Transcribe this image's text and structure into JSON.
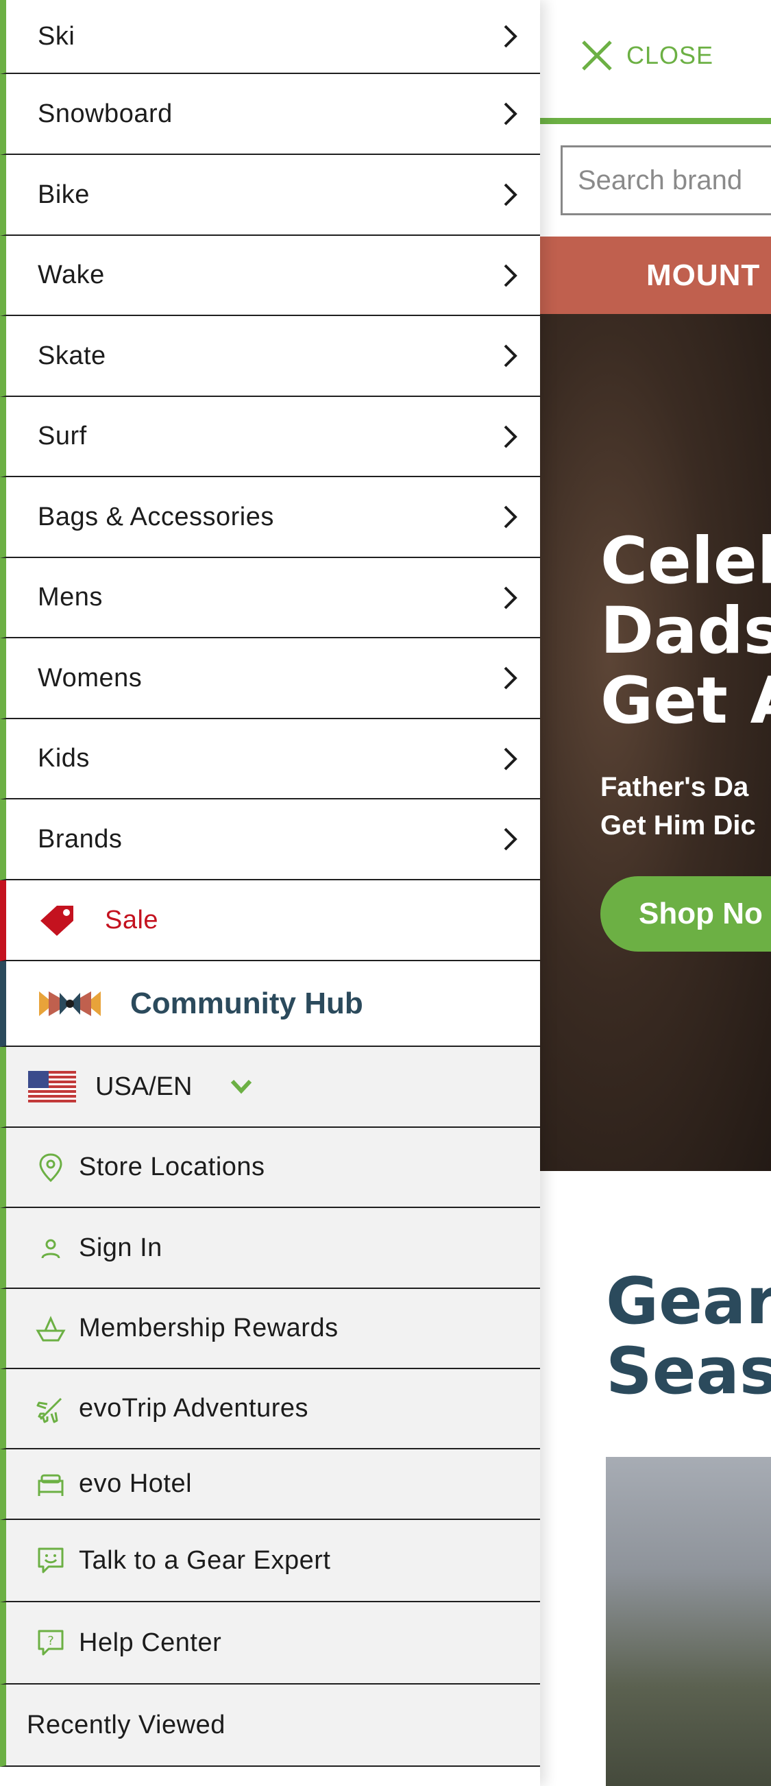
{
  "colors": {
    "accent_green": "#6cb044",
    "sale_red": "#c4121f",
    "community_navy": "#2b4a5c",
    "promo_bar": "#c0604e"
  },
  "drawer": {
    "categories": [
      {
        "label": "Ski"
      },
      {
        "label": "Snowboard"
      },
      {
        "label": "Bike"
      },
      {
        "label": "Wake"
      },
      {
        "label": "Skate"
      },
      {
        "label": "Surf"
      },
      {
        "label": "Bags & Accessories"
      },
      {
        "label": "Mens"
      },
      {
        "label": "Womens"
      },
      {
        "label": "Kids"
      },
      {
        "label": "Brands"
      }
    ],
    "sale": {
      "label": "Sale",
      "icon": "price-tag-icon"
    },
    "community": {
      "label": "Community Hub",
      "icon": "community-logo-icon"
    },
    "locale": {
      "label": "USA/EN",
      "icon": "us-flag-icon"
    },
    "utility_links": [
      {
        "label": "Store Locations",
        "icon": "map-pin-icon"
      },
      {
        "label": "Sign In",
        "icon": "user-icon"
      },
      {
        "label": "Membership Rewards",
        "icon": "rewards-icon"
      },
      {
        "label": "evoTrip Adventures",
        "icon": "airplane-icon"
      },
      {
        "label": "evo Hotel",
        "icon": "bed-icon"
      },
      {
        "label": "Talk to a Gear Expert",
        "icon": "chat-smile-icon"
      },
      {
        "label": "Help Center",
        "icon": "help-bubble-icon"
      }
    ],
    "recently_viewed": {
      "label": "Recently Viewed"
    }
  },
  "page": {
    "close_label": "CLOSE",
    "search_placeholder": "Search brand",
    "promo_text": "MOUNT",
    "hero_title": "Celebr\nDads V\nGet Af",
    "hero_subtitle": "Father's Da\nGet Him Dic",
    "shop_button": "Shop No",
    "section_title": "Gear u\nSeaso"
  }
}
